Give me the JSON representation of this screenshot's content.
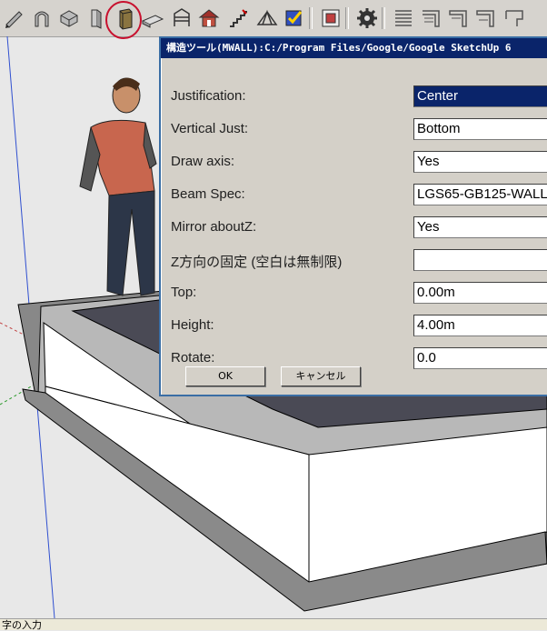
{
  "toolbar": {
    "buttons": [
      "pencil-icon",
      "arch-icon",
      "box-icon",
      "plate-icon",
      "wall-tool-icon",
      "beam-icon",
      "frame-icon",
      "house-icon",
      "stair-icon",
      "truss-icon",
      "check-icon",
      "window-icon",
      "gear-icon",
      "wall-panel-1-icon",
      "wall-panel-2-icon",
      "wall-panel-3-icon",
      "wall-panel-4-icon",
      "wall-panel-5-icon"
    ]
  },
  "dialog": {
    "title": "構造ツール(MWALL):C:/Program Files/Google/Google SketchUp 6",
    "fields": [
      {
        "label": "Justification:",
        "value": "Center"
      },
      {
        "label": "Vertical Just:",
        "value": "Bottom"
      },
      {
        "label": "Draw axis:",
        "value": "Yes"
      },
      {
        "label": "Beam Spec:",
        "value": "LGS65-GB125-WALL"
      },
      {
        "label": "Mirror aboutZ:",
        "value": "Yes"
      },
      {
        "label": "Z方向の固定 (空白は無制限)",
        "value": ""
      },
      {
        "label": "Top:",
        "value": "0.00m"
      },
      {
        "label": "Height:",
        "value": "4.00m"
      },
      {
        "label": "Rotate:",
        "value": "0.0"
      }
    ],
    "ok_label": "OK",
    "cancel_label": "キャンセル"
  },
  "statusbar": {
    "text": "字の入力"
  },
  "colors": {
    "title_bg": "#0a246a",
    "dialog_bg": "#d4d0c8",
    "highlight_circle": "#c8102e"
  }
}
